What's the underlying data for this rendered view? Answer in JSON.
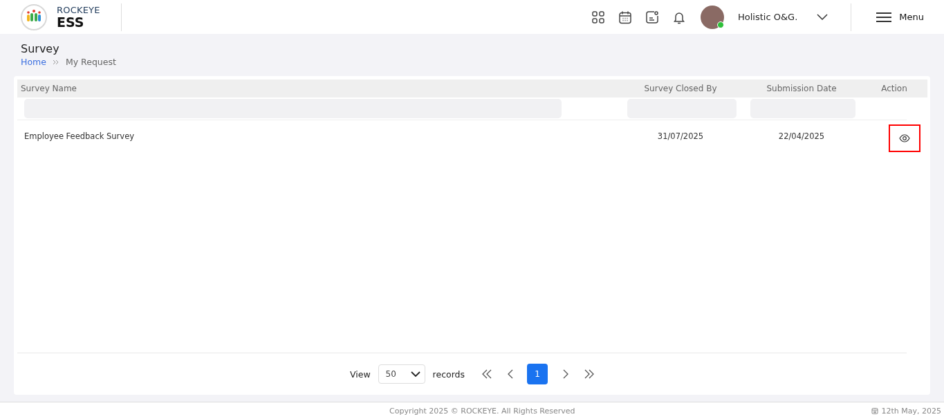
{
  "header": {
    "brand_top": "ROCKEYE",
    "brand_bottom": "ESS",
    "user_name": "Holistic O&G.",
    "user_online": true,
    "menu_label": "Menu"
  },
  "page": {
    "title": "Survey",
    "breadcrumb": [
      {
        "label": "Home",
        "kind": "link"
      },
      {
        "label": "My Request",
        "kind": "current"
      }
    ]
  },
  "table": {
    "columns": [
      "Survey Name",
      "Survey Closed By",
      "Submission Date",
      "Action"
    ],
    "rows": [
      {
        "survey_name": "Employee Feedback Survey",
        "closed_by": "31/07/2025",
        "submission_date": "22/04/2025"
      }
    ]
  },
  "pagination": {
    "view_label": "View",
    "page_size": "50",
    "records_label": "records",
    "pages": [
      {
        "label": "1",
        "selected": true
      }
    ]
  },
  "footer": {
    "copyright": "Copyright 2025 © ROCKEYE. All Rights Reserved",
    "date": "12th May, 2025"
  }
}
